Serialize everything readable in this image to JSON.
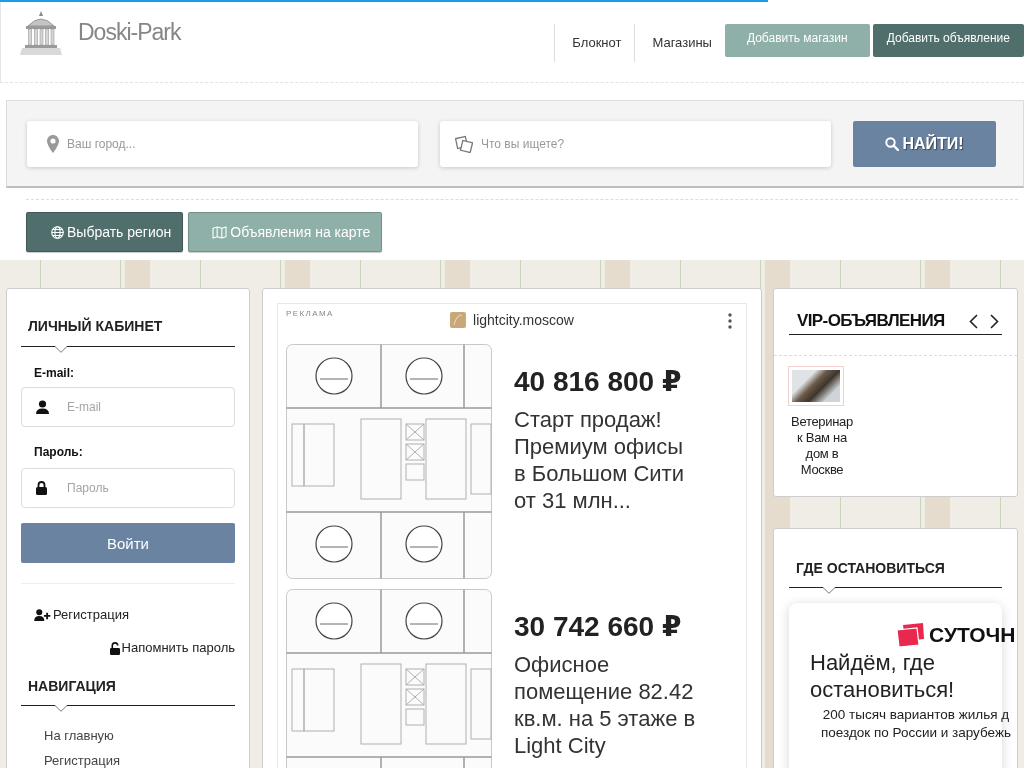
{
  "loading_bar": {
    "level": 0.75
  },
  "header": {
    "site_name": "Doski-Park",
    "links": [
      "Блокнот",
      "Магазины"
    ],
    "buttons": [
      {
        "label": "Добавить магазин",
        "kind": "secondary"
      },
      {
        "label": "Добавить объявление",
        "kind": "primary"
      }
    ]
  },
  "search": {
    "fields": [
      {
        "kind": "city",
        "placeholder": "Ваш город..."
      },
      {
        "kind": "query",
        "placeholder": "Что вы ищете?"
      }
    ],
    "button": "НАЙТИ!"
  },
  "actions": [
    {
      "label": "Выбрать регион",
      "kind": "region"
    },
    {
      "label": "Объявления на карте",
      "kind": "map"
    }
  ],
  "login": {
    "title": "ЛИЧНЫЙ КАБИНЕТ",
    "fields": [
      {
        "label": "E-mail:",
        "placeholder": "E-mail",
        "kind": "email"
      },
      {
        "label": "Пароль:",
        "placeholder": "Пароль",
        "kind": "password"
      }
    ],
    "submit": "Войти",
    "register_link": "Регистрация",
    "remind_link": "Напомнить пароль"
  },
  "navigation": {
    "title": "НАВИГАЦИЯ",
    "links": [
      "На главную",
      "Регистрация"
    ]
  },
  "ad": {
    "label": "РЕКЛАМА",
    "domain": "lightcity.moscow",
    "items": [
      {
        "price": "40 816 800 ₽",
        "text": "Старт продаж! Премиум офисы в Большом Сити от 31 млн..."
      },
      {
        "price": "30 742 660 ₽",
        "text": "Офисное помещение 82.42 кв.м. на 5 этаже в Light City"
      }
    ]
  },
  "vip": {
    "title": "VIP-ОБЪЯВЛЕНИЯ",
    "items": [
      {
        "title": "Ветеринар к Вам на дом в Москве"
      }
    ]
  },
  "stay": {
    "title": "ГДЕ ОСТАНОВИТЬСЯ",
    "ad": {
      "brand": "СУТОЧН",
      "headline": "Найдём, где остановиться!",
      "text": "200 тысяч вариантов жилья д\nпоездок по России и зарубежь"
    }
  }
}
